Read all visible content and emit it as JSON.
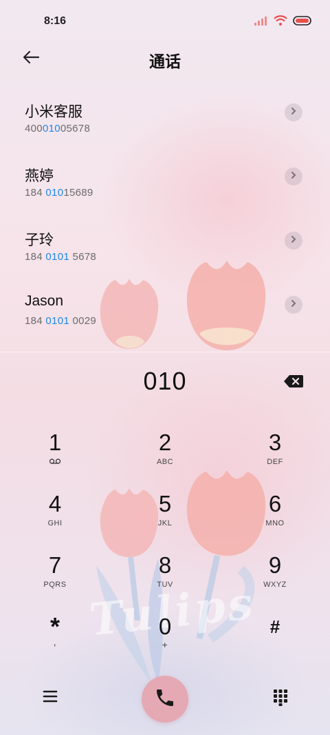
{
  "status_bar": {
    "time": "8:16"
  },
  "header": {
    "title": "通话"
  },
  "contacts": [
    {
      "name": "小米客服",
      "number_pre": "400",
      "number_hl": "010",
      "number_post": "05678"
    },
    {
      "name": "燕婷",
      "number_pre": "184 ",
      "number_hl": "010",
      "number_post": "15689"
    },
    {
      "name": "子玲",
      "number_pre": "184 ",
      "number_hl": "0101",
      "number_post": " 5678"
    },
    {
      "name": "Jason",
      "number_pre": "184 ",
      "number_hl": "0101",
      "number_post": " 0029"
    }
  ],
  "dialer": {
    "input": "010",
    "keys": [
      {
        "digit": "1",
        "sub": ""
      },
      {
        "digit": "2",
        "sub": "ABC"
      },
      {
        "digit": "3",
        "sub": "DEF"
      },
      {
        "digit": "4",
        "sub": "GHI"
      },
      {
        "digit": "5",
        "sub": "JKL"
      },
      {
        "digit": "6",
        "sub": "MNO"
      },
      {
        "digit": "7",
        "sub": "PQRS"
      },
      {
        "digit": "8",
        "sub": "TUV"
      },
      {
        "digit": "9",
        "sub": "WXYZ"
      },
      {
        "digit": "*",
        "sub": ","
      },
      {
        "digit": "0",
        "sub": "+"
      },
      {
        "digit": "#",
        "sub": ""
      }
    ]
  },
  "wallpaper": {
    "text": "Tulips"
  },
  "colors": {
    "highlight": "#1e88e5",
    "call_button": "#e6a0aa"
  },
  "icons": {
    "back": "arrow-left-icon",
    "chevron": "chevron-right-icon",
    "backspace": "backspace-icon",
    "voicemail": "voicemail-icon",
    "menu": "menu-icon",
    "call": "phone-icon",
    "keypad": "dialpad-icon"
  }
}
